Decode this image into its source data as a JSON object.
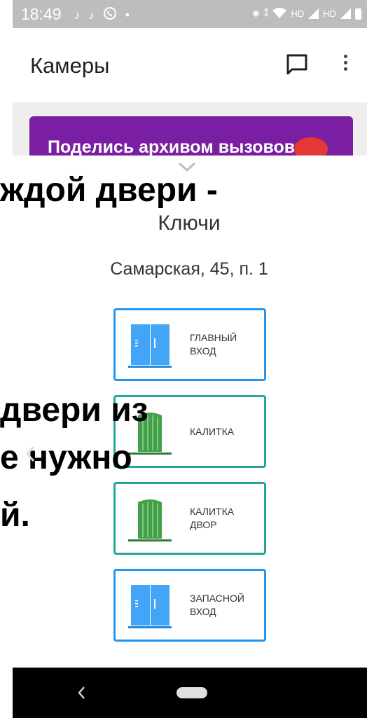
{
  "status_bar": {
    "time": "18:49",
    "left_icons": [
      "tiktok-icon",
      "tiktok-icon",
      "whatsapp-icon",
      "dot-icon"
    ],
    "right_icons": [
      "bluetooth-icon",
      "vibrate-icon",
      "wifi-icon",
      "signal-icon",
      "signal-icon",
      "battery-icon"
    ],
    "hd1": "HD",
    "hd2": "HD",
    "dot": "•"
  },
  "app_bar": {
    "title": "Камеры",
    "chat_icon": "chat-icon",
    "more_icon": "more-vertical-icon"
  },
  "promo": {
    "text": "Поделись архивом вызовов",
    "bg_color": "#7b1fa2"
  },
  "sheet": {
    "title": "Ключи",
    "address": "Самарская, 45, п. 1",
    "keys": [
      {
        "label": "ГЛАВНЫЙ ВХОД",
        "icon": "double-door-icon",
        "border_color": "#2196f3"
      },
      {
        "label": "КАЛИТКА",
        "icon": "gate-icon",
        "border_color": "#26a69a"
      },
      {
        "label": "КАЛИТКА ДВОР",
        "icon": "gate-icon",
        "border_color": "#26a69a"
      },
      {
        "label": "ЗАПАСНОЙ ВХОД",
        "icon": "double-door-icon",
        "border_color": "#2196f3"
      }
    ]
  },
  "overlay_caption": {
    "line1": "ждой двери -",
    "line2": "двери из",
    "line3": "е нужно",
    "line4": "й."
  },
  "nav_bar": {
    "back_icon": "back-icon",
    "home_icon": "home-pill-icon"
  }
}
